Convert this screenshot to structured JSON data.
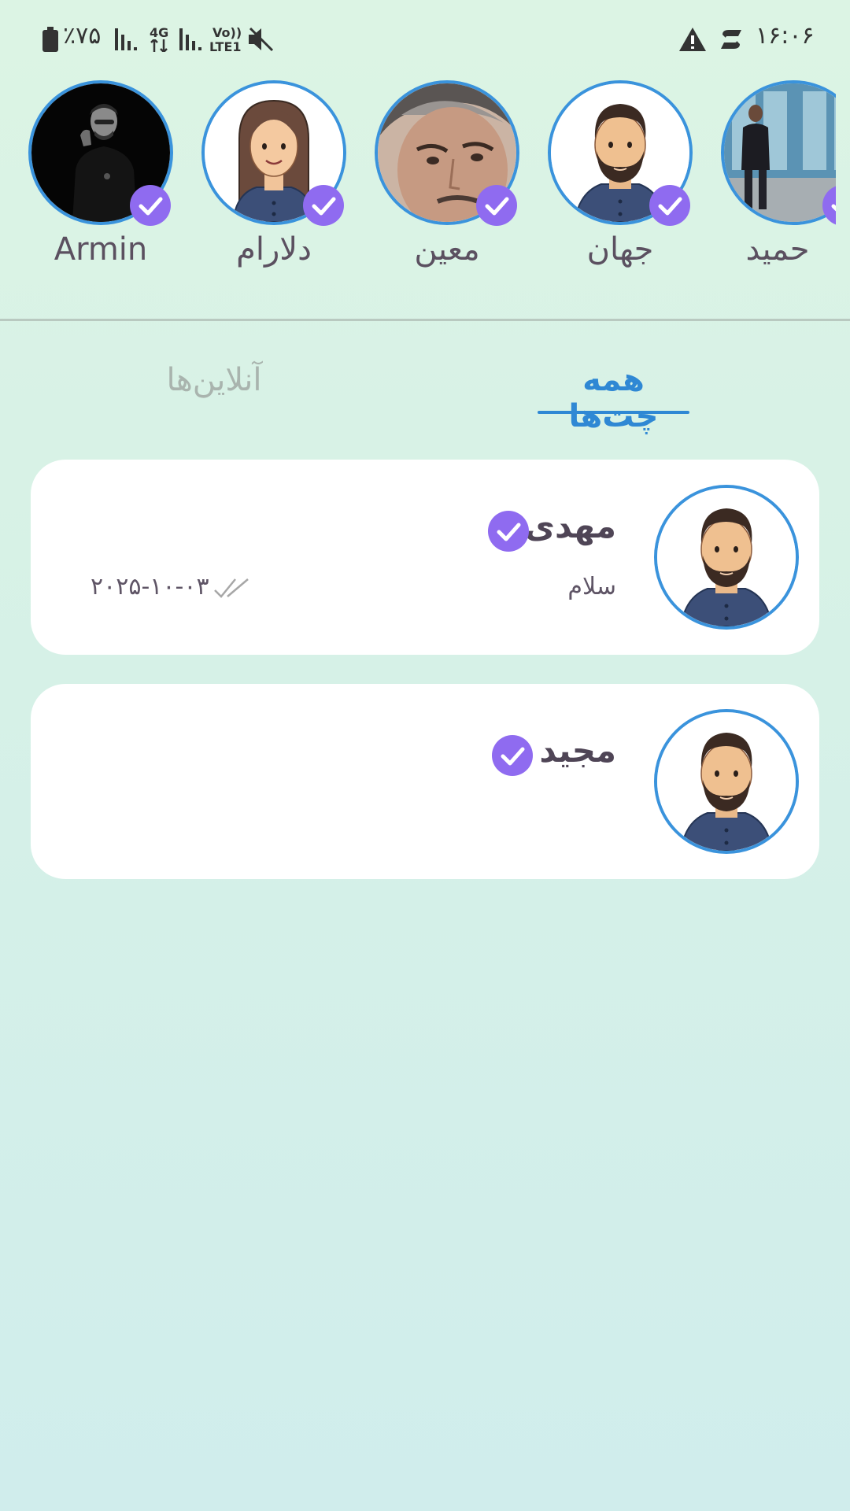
{
  "status_bar": {
    "time": "۱۶:۰۶",
    "battery": "٪۷۵",
    "network_4g": "4G",
    "volte_top": "Vo))",
    "volte_bottom": "LTE1",
    "icons": [
      "warning-icon",
      "data-saver-icon",
      "battery-icon",
      "signal-icon",
      "mute-icon"
    ]
  },
  "stories": [
    {
      "name": "Armin",
      "avatar": "photo-dark"
    },
    {
      "name": "دلارام",
      "avatar": "cartoon-woman"
    },
    {
      "name": "معین",
      "avatar": "photo-face"
    },
    {
      "name": "جهان",
      "avatar": "cartoon-man"
    },
    {
      "name": "حمید",
      "avatar": "photo-outdoor"
    }
  ],
  "tabs": {
    "all_chats": "همه چت‌ها",
    "online": "آنلاین‌ها",
    "active": "all_chats"
  },
  "chats": [
    {
      "name": "مهدی",
      "last_message": "سلام",
      "date": "۲۰۲۵-۱۰-۰۳",
      "verified": true
    },
    {
      "name": "مجید",
      "last_message": "",
      "date": "",
      "verified": true
    }
  ],
  "colors": {
    "accent": "#2f88d4",
    "badge": "#8f6bf0",
    "text": "#4f4556"
  }
}
